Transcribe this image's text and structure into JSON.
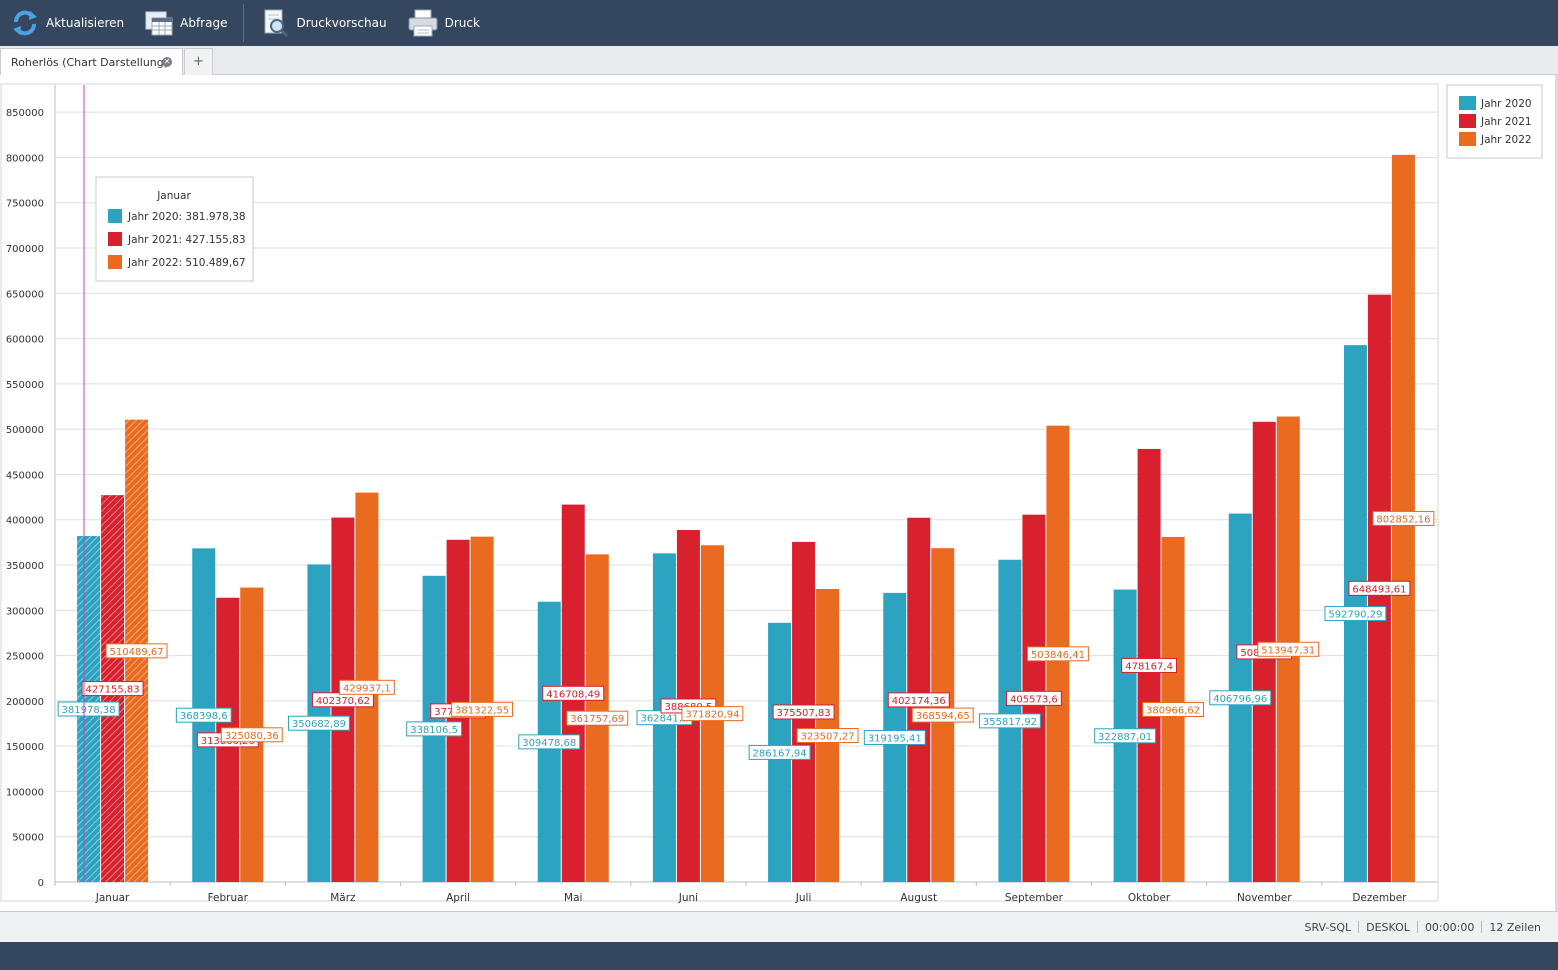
{
  "toolbar": {
    "refresh_label": "Aktualisieren",
    "query_label": "Abfrage",
    "preview_label": "Druckvorschau",
    "print_label": "Druck"
  },
  "tabs": {
    "active_label": "Roherlös (Chart Darstellung)",
    "close_symbol": "✕",
    "add_symbol": "+"
  },
  "tooltip": {
    "title": "Januar",
    "lines": [
      "Jahr 2020: 381.978,38",
      "Jahr 2021: 427.155,83",
      "Jahr 2022: 510.489,67"
    ]
  },
  "status": {
    "server": "SRV-SQL",
    "user": "DESKOL",
    "time": "00:00:00",
    "rows": "12 Zeilen"
  },
  "colors": {
    "2020": "#2ca3c1",
    "2021": "#d9202e",
    "2022": "#ea6a1f",
    "toolbar": "#34475e",
    "crosshair": "#c040c8"
  },
  "chart_data": {
    "type": "bar",
    "categories": [
      "Januar",
      "Februar",
      "März",
      "April",
      "Mai",
      "Juni",
      "Juli",
      "August",
      "September",
      "Oktober",
      "November",
      "Dezember"
    ],
    "series": [
      {
        "name": "Jahr 2020",
        "values": [
          381978.38,
          368398.6,
          350682.89,
          338106.5,
          309478.68,
          362841.7,
          286167.94,
          319195.41,
          355817.92,
          322887.01,
          406796.96,
          592790.29
        ],
        "labels": [
          "381978,38",
          "368398,6",
          "350682,89",
          "338106,5",
          "309478,68",
          "362841,7",
          "286167,94",
          "319195,41",
          "355817,92",
          "322887,01",
          "406796,96",
          "592790,29"
        ]
      },
      {
        "name": "Jahr 2021",
        "values": [
          427155.83,
          313866.26,
          402370.62,
          377876.2,
          416708.49,
          388680.5,
          375507.83,
          402174.36,
          405573.6,
          478167.4,
          508125.3,
          648493.61
        ],
        "labels": [
          "427155,83",
          "313866,26",
          "402370,62",
          "377876,2",
          "416708,49",
          "388680,5",
          "375507,83",
          "402174,36",
          "405573,6",
          "478167,4",
          "508125,3",
          "648493,61"
        ]
      },
      {
        "name": "Jahr 2022",
        "values": [
          510489.67,
          325080.36,
          429937.1,
          381322.55,
          361757.69,
          371820.94,
          323507.27,
          368594.65,
          503846.41,
          380966.62,
          513947.31,
          802852.16
        ],
        "labels": [
          "510489,67",
          "325080,36",
          "429937,1",
          "381322,55",
          "361757,69",
          "371820,94",
          "323507,27",
          "368594,65",
          "503846,41",
          "380966,62",
          "513947,31",
          "802852,16"
        ]
      }
    ],
    "ylim": [
      0,
      880000
    ],
    "yticks": [
      0,
      50000,
      100000,
      150000,
      200000,
      250000,
      300000,
      350000,
      400000,
      450000,
      500000,
      550000,
      600000,
      650000,
      700000,
      750000,
      800000,
      850000
    ],
    "grid": true,
    "legend_position": "top-right",
    "highlighted_category": "Januar"
  }
}
